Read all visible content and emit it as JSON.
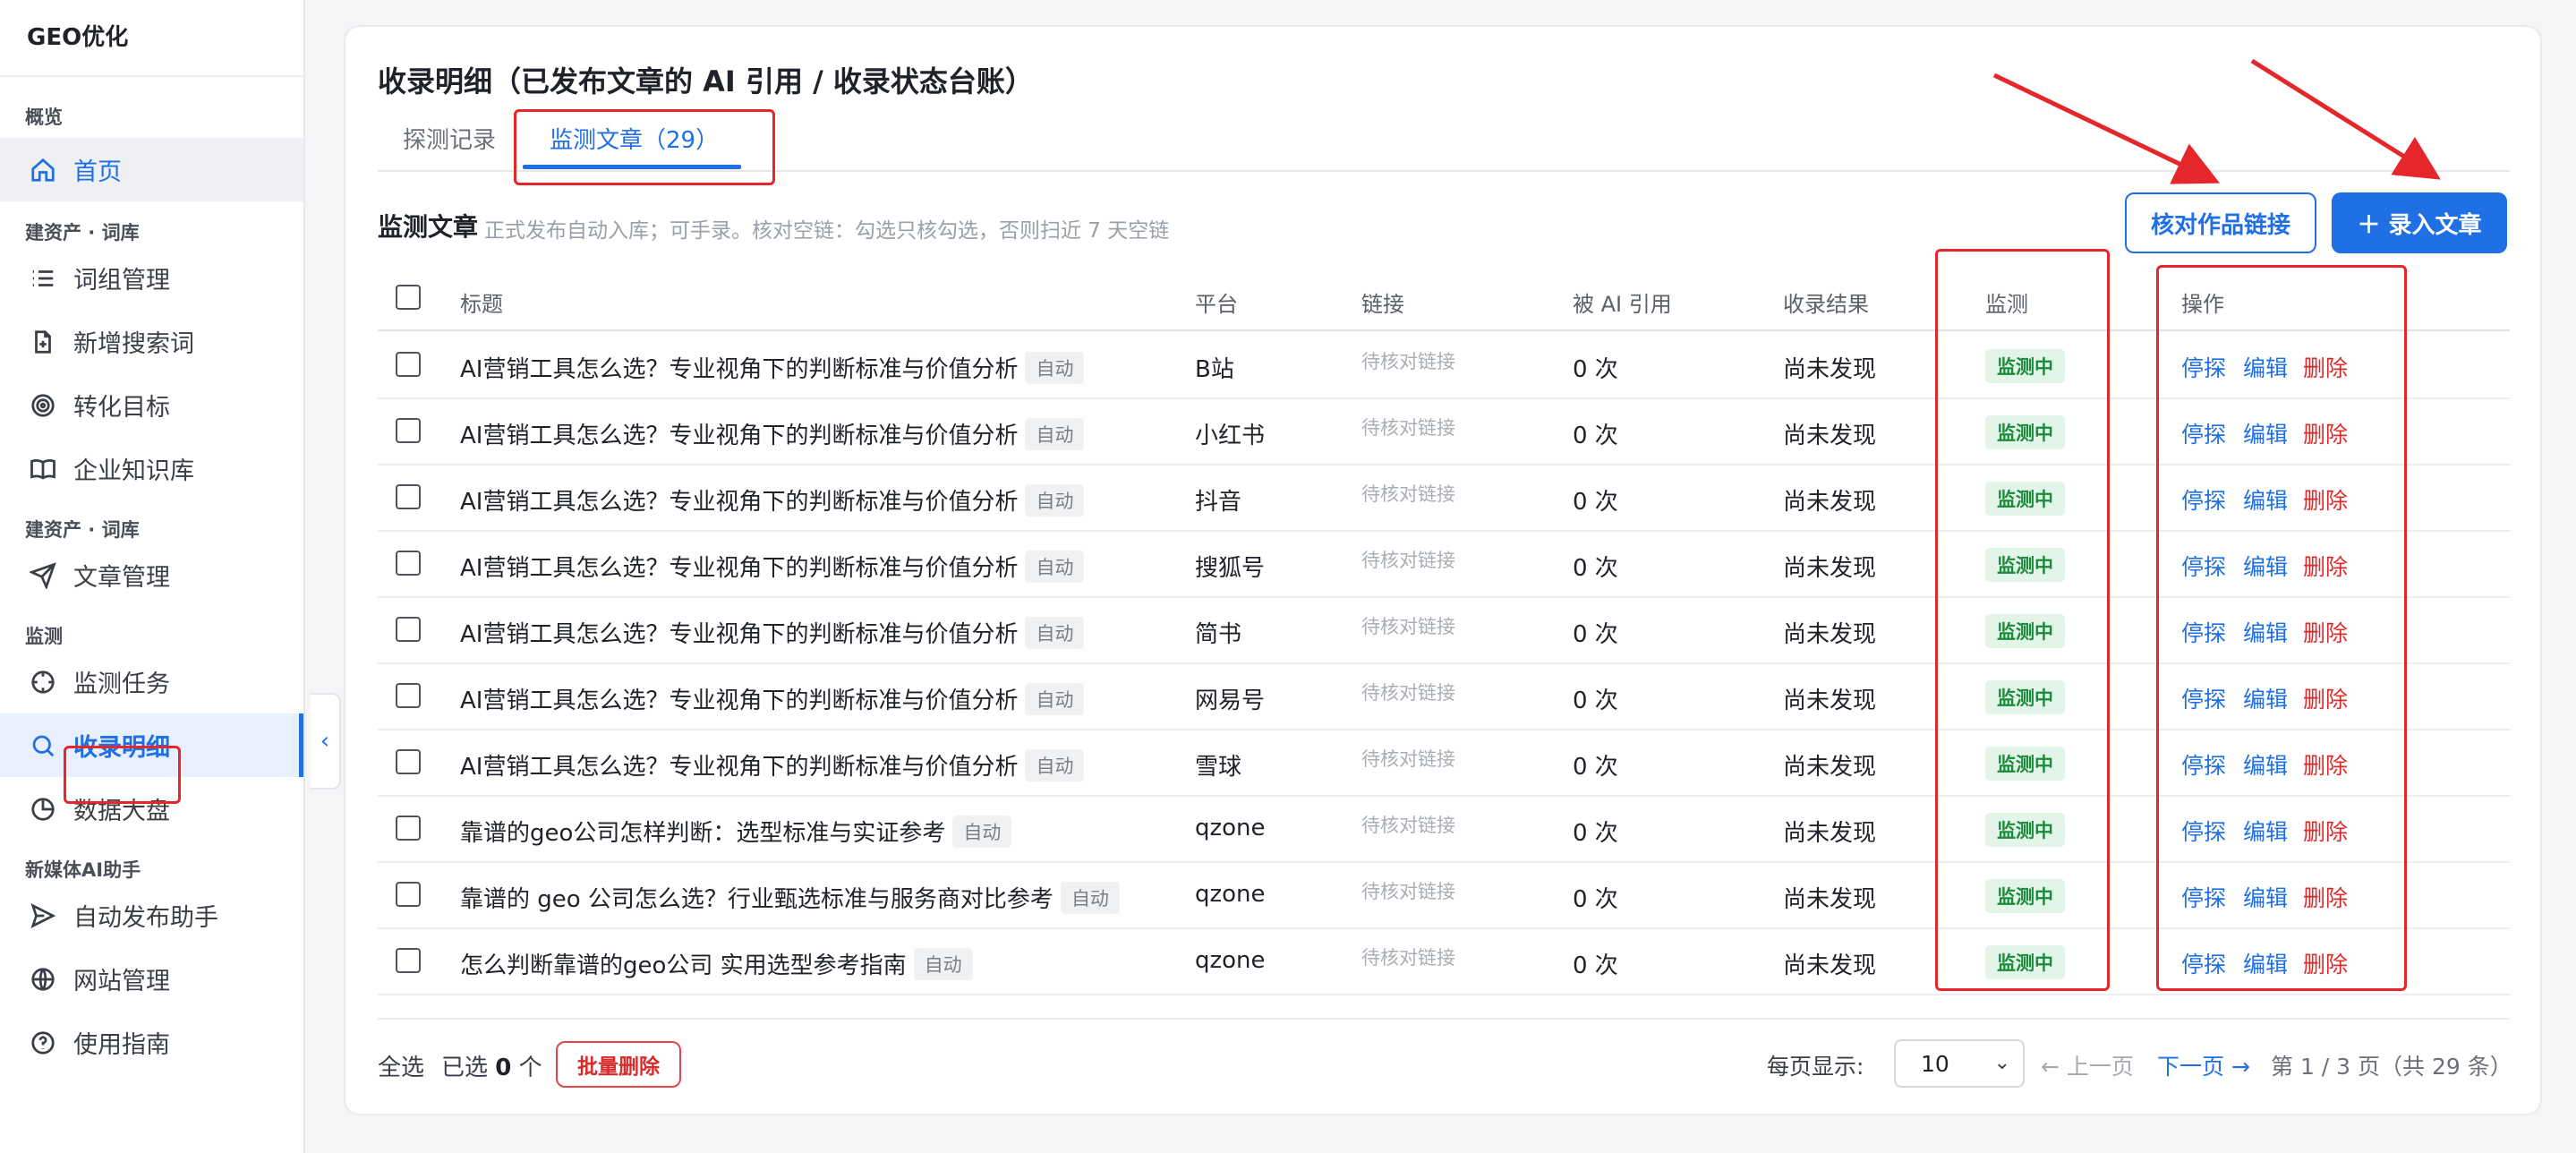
{
  "brand": "GEO优化",
  "sidebar": {
    "sections": [
      {
        "title": "概览"
      },
      {
        "title": "建资产 · 词库"
      },
      {
        "title": "建资产 · 词库"
      },
      {
        "title": "监测"
      },
      {
        "title": "新媒体AI助手"
      }
    ],
    "items": [
      {
        "label": "首页",
        "icon": "home-icon"
      },
      {
        "label": "词组管理",
        "icon": "list-icon"
      },
      {
        "label": "新增搜索词",
        "icon": "file-plus-icon"
      },
      {
        "label": "转化目标",
        "icon": "target-icon"
      },
      {
        "label": "企业知识库",
        "icon": "book-icon"
      },
      {
        "label": "文章管理",
        "icon": "send-icon"
      },
      {
        "label": "监测任务",
        "icon": "crosshair-icon"
      },
      {
        "label": "收录明细",
        "icon": "search-icon"
      },
      {
        "label": "数据大盘",
        "icon": "pie-chart-icon"
      },
      {
        "label": "自动发布助手",
        "icon": "send-icon"
      },
      {
        "label": "网站管理",
        "icon": "globe-icon"
      },
      {
        "label": "使用指南",
        "icon": "help-circle-icon"
      }
    ]
  },
  "header": {
    "title": "收录明细（已发布文章的 AI 引用 / 收录状态台账）",
    "tabs": [
      {
        "label": "探测记录"
      },
      {
        "label": "监测文章（29）"
      }
    ]
  },
  "section": {
    "title": "监测文章",
    "note": "正式发布自动入库；可手录。核对空链：勾选只核勾选，否则扫近 7 天空链",
    "verify_button": "核对作品链接",
    "add_button": "＋ 录入文章"
  },
  "table": {
    "columns": [
      "标题",
      "平台",
      "链接",
      "被 AI 引用",
      "收录结果",
      "监测",
      "操作"
    ],
    "auto_tag": "自动",
    "ops": [
      "停探",
      "编辑",
      "删除"
    ],
    "rows": [
      {
        "title": "AI营销工具怎么选？专业视角下的判断标准与价值分析",
        "platform": "B站",
        "link": "待核对链接",
        "cited": "0 次",
        "result": "尚未发现",
        "status": "监测中"
      },
      {
        "title": "AI营销工具怎么选？专业视角下的判断标准与价值分析",
        "platform": "小红书",
        "link": "待核对链接",
        "cited": "0 次",
        "result": "尚未发现",
        "status": "监测中"
      },
      {
        "title": "AI营销工具怎么选？专业视角下的判断标准与价值分析",
        "platform": "抖音",
        "link": "待核对链接",
        "cited": "0 次",
        "result": "尚未发现",
        "status": "监测中"
      },
      {
        "title": "AI营销工具怎么选？专业视角下的判断标准与价值分析",
        "platform": "搜狐号",
        "link": "待核对链接",
        "cited": "0 次",
        "result": "尚未发现",
        "status": "监测中"
      },
      {
        "title": "AI营销工具怎么选？专业视角下的判断标准与价值分析",
        "platform": "简书",
        "link": "待核对链接",
        "cited": "0 次",
        "result": "尚未发现",
        "status": "监测中"
      },
      {
        "title": "AI营销工具怎么选？专业视角下的判断标准与价值分析",
        "platform": "网易号",
        "link": "待核对链接",
        "cited": "0 次",
        "result": "尚未发现",
        "status": "监测中"
      },
      {
        "title": "AI营销工具怎么选？专业视角下的判断标准与价值分析",
        "platform": "雪球",
        "link": "待核对链接",
        "cited": "0 次",
        "result": "尚未发现",
        "status": "监测中"
      },
      {
        "title": "靠谱的geo公司怎样判断：选型标准与实证参考",
        "platform": "qzone",
        "link": "待核对链接",
        "cited": "0 次",
        "result": "尚未发现",
        "status": "监测中"
      },
      {
        "title": "靠谱的 geo 公司怎么选？行业甄选标准与服务商对比参考",
        "platform": "qzone",
        "link": "待核对链接",
        "cited": "0 次",
        "result": "尚未发现",
        "status": "监测中"
      },
      {
        "title": "怎么判断靠谱的geo公司 实用选型参考指南",
        "platform": "qzone",
        "link": "待核对链接",
        "cited": "0 次",
        "result": "尚未发现",
        "status": "监测中"
      }
    ]
  },
  "footer": {
    "select_all": "全选",
    "selected_prefix": "已选",
    "selected_count": "0",
    "selected_suffix": "个",
    "batch_delete": "批量删除",
    "per_page_label": "每页显示:",
    "page_size": "10",
    "prev": "← 上一页",
    "next": "下一页 →",
    "page_info": "第 1 / 3 页（共 29 条）"
  },
  "colors": {
    "accent": "#1f6fe5",
    "annotation_red": "#e5262b",
    "status_green": "#1a8a3b",
    "delete_red": "#d92b2b"
  }
}
